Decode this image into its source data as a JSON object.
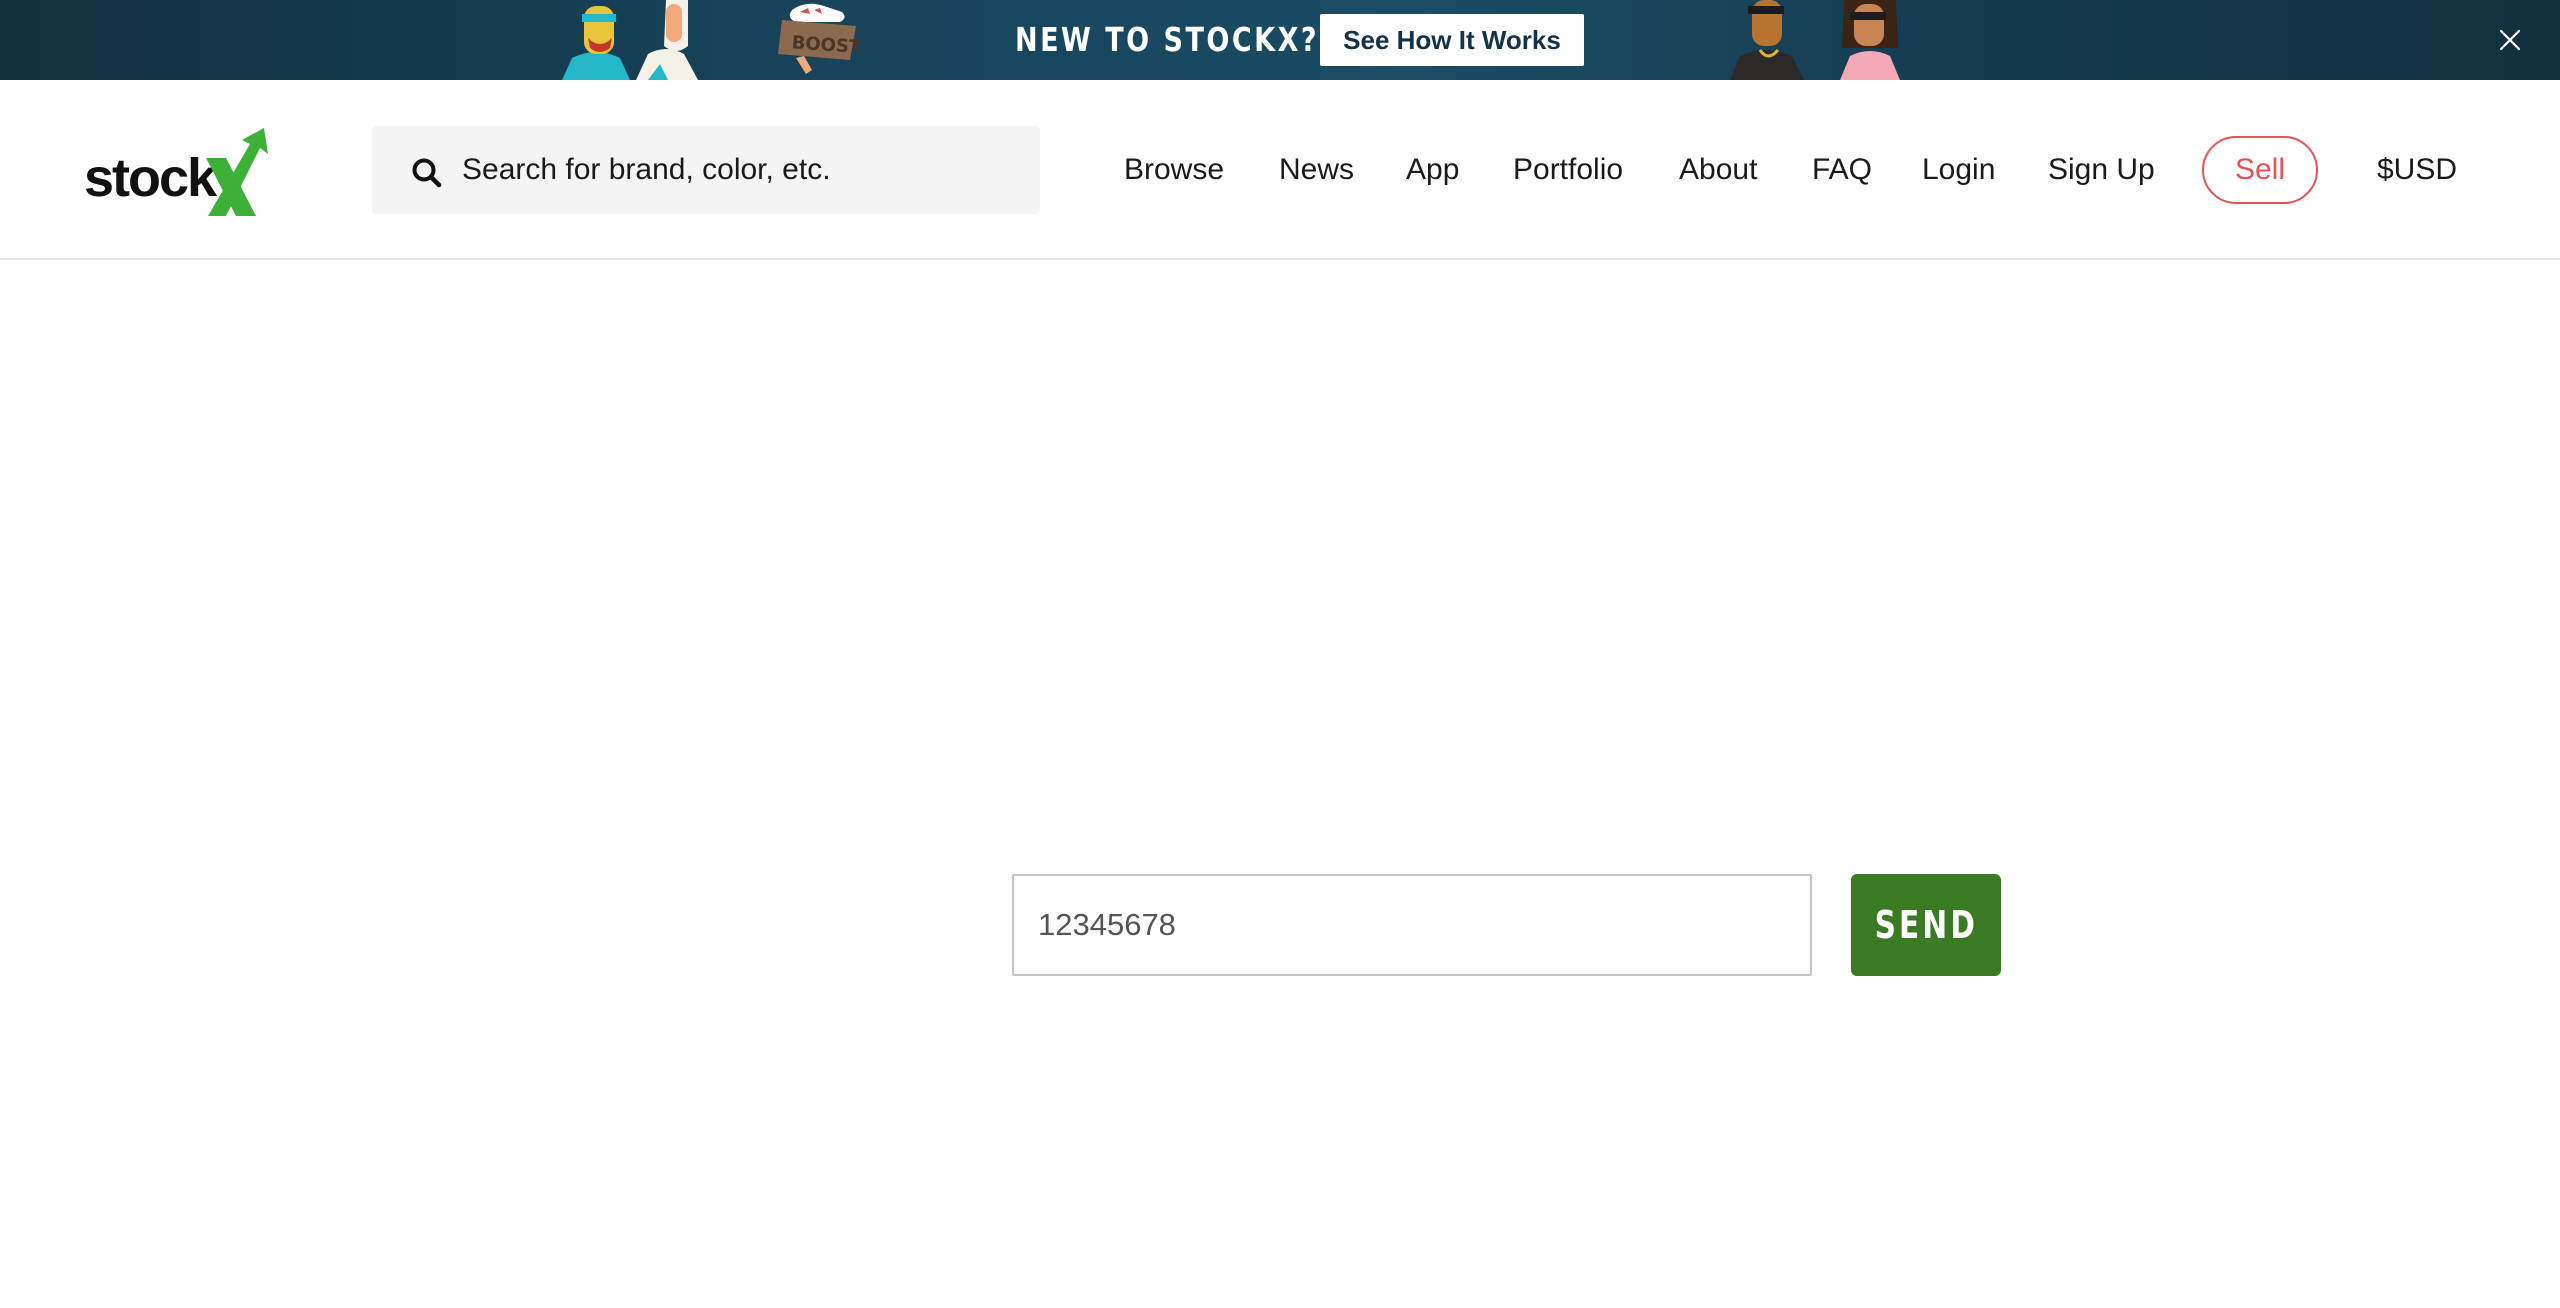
{
  "banner": {
    "headline": "NEW TO STOCKX?",
    "cta_label": "See How It Works",
    "box_text": "BOOST",
    "close_label": "X",
    "close_icon": "close-icon",
    "background_color": "#17425a"
  },
  "header": {
    "logo_text": "stock",
    "logo_mark": "X",
    "brand_green": "#3db037",
    "search": {
      "placeholder": "Search for brand, color, etc.",
      "value": "",
      "icon": "search-icon"
    },
    "nav": [
      {
        "label": "Browse"
      },
      {
        "label": "News"
      },
      {
        "label": "App"
      },
      {
        "label": "Portfolio"
      },
      {
        "label": "About"
      },
      {
        "label": "FAQ"
      },
      {
        "label": "Login"
      },
      {
        "label": "Sign Up"
      }
    ],
    "sell_label": "Sell",
    "sell_color": "#e8505b",
    "currency_label": "$USD"
  },
  "form": {
    "code_value": "12345678",
    "send_label": "SEND",
    "send_color": "#3a7a23"
  }
}
